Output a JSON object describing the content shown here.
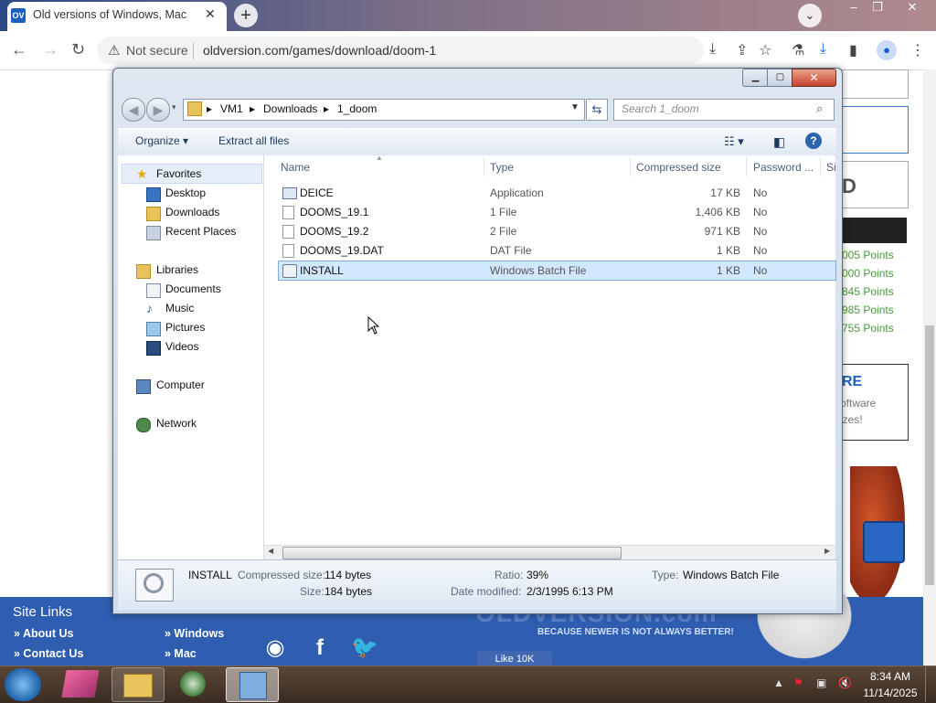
{
  "browser": {
    "tab_title": "Old versions of Windows, Mac a",
    "tab_favicon_text": "OV",
    "not_secure": "Not secure",
    "url": "oldversion.com/games/download/doom-1"
  },
  "page": {
    "points": [
      "005 Points",
      "000 Points",
      "845 Points",
      "985 Points",
      "755 Points"
    ],
    "promo_title": "RE",
    "promo_line1": "oftware",
    "promo_line2": "izes!",
    "sidebox_text": "D",
    "footer": {
      "site_links_title": "Site Links",
      "links_col1": [
        "» About Us",
        "» Contact Us"
      ],
      "links_col2": [
        "» Windows",
        "» Mac"
      ],
      "watermark": "OLDVERSION.com",
      "tagline": "BECAUSE NEWER IS NOT ALWAYS BETTER!",
      "like_label": "Like 10K"
    }
  },
  "explorer": {
    "breadcrumbs": [
      "VM1",
      "Downloads",
      "1_doom"
    ],
    "search_placeholder": "Search 1_doom",
    "commands": {
      "organize": "Organize ▾",
      "extract": "Extract all files"
    },
    "nav": {
      "favorites_label": "Favorites",
      "favorites": [
        "Desktop",
        "Downloads",
        "Recent Places"
      ],
      "libraries_label": "Libraries",
      "libraries": [
        "Documents",
        "Music",
        "Pictures",
        "Videos"
      ],
      "computer": "Computer",
      "network": "Network"
    },
    "columns": [
      "Name",
      "Type",
      "Compressed size",
      "Password ...",
      "Si"
    ],
    "files": [
      {
        "name": "DEICE",
        "type": "Application",
        "size": "17 KB",
        "password": "No"
      },
      {
        "name": "DOOMS_19.1",
        "type": "1 File",
        "size": "1,406 KB",
        "password": "No"
      },
      {
        "name": "DOOMS_19.2",
        "type": "2 File",
        "size": "971 KB",
        "password": "No"
      },
      {
        "name": "DOOMS_19.DAT",
        "type": "DAT File",
        "size": "1 KB",
        "password": "No"
      },
      {
        "name": "INSTALL",
        "type": "Windows Batch File",
        "size": "1 KB",
        "password": "No"
      }
    ],
    "details": {
      "name": "INSTALL",
      "compressed_label": "Compressed size:",
      "compressed_value": "114 bytes",
      "size_label": "Size:",
      "size_value": "184 bytes",
      "ratio_label": "Ratio:",
      "ratio_value": "39%",
      "modified_label": "Date modified:",
      "modified_value": "2/3/1995 6:13 PM",
      "type_label": "Type:",
      "type_value": "Windows Batch File"
    }
  },
  "taskbar": {
    "time": "8:34 AM",
    "date": "11/14/2025"
  }
}
